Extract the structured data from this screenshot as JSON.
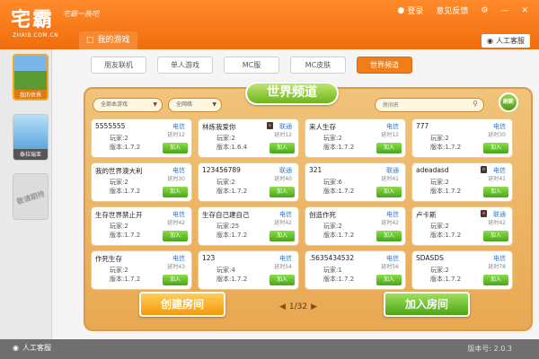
{
  "app": {
    "logo_text": "宅霸",
    "logo_sub": "ZHAIB.COM.CN",
    "slogan": "宅霸一族吧",
    "login": "登录",
    "feedback": "意见反馈",
    "minimize": "—",
    "close": "✕",
    "my_games_tab": "我的游戏",
    "support_top": "人工客服"
  },
  "sidebar": {
    "items": [
      {
        "label": "我的世界"
      },
      {
        "label": "泰拉瑞亚"
      },
      {
        "label": "敬请期待"
      }
    ]
  },
  "subtabs": [
    {
      "label": "朋友联机"
    },
    {
      "label": "单人游戏"
    },
    {
      "label": "MC服"
    },
    {
      "label": "MC皮肤"
    },
    {
      "label": "世界频道"
    }
  ],
  "board": {
    "title": "世界频道",
    "filter_version": "全部本游戏",
    "filter_net": "全网络",
    "search_placeholder": "房间名",
    "refresh": "刷新",
    "create_button": "创建房间",
    "join_button": "加入房间",
    "page": "1/32"
  },
  "rooms": [
    {
      "name": "5555555",
      "net": "电信",
      "latency": "延时12",
      "players": "玩家:2",
      "version": "版本:1.7.2",
      "join": "加入",
      "locked": false
    },
    {
      "name": "林炼我爱你",
      "net": "联通",
      "latency": "延时12",
      "players": "玩家:2",
      "version": "版本:1.6.4",
      "join": "加入",
      "locked": true
    },
    {
      "name": "来人生存",
      "net": "电信",
      "latency": "延时12",
      "players": "玩家:2",
      "version": "版本:1.7.2",
      "join": "加入",
      "locked": false
    },
    {
      "name": "777",
      "net": "电信",
      "latency": "延时30",
      "players": "玩家:2",
      "version": "版本:1.7.2",
      "join": "加入",
      "locked": false
    },
    {
      "name": "我的世界澳大利",
      "net": "电信",
      "latency": "延时30",
      "players": "玩家:2",
      "version": "版本:1.7.2",
      "join": "加入",
      "locked": false
    },
    {
      "name": "123456789",
      "net": "联通",
      "latency": "延时40",
      "players": "玩家:2",
      "version": "版本:1.7.2",
      "join": "加入",
      "locked": false
    },
    {
      "name": "321",
      "net": "联通",
      "latency": "延时41",
      "players": "玩家:6",
      "version": "版本:1.7.2",
      "join": "加入",
      "locked": false
    },
    {
      "name": "adeadasd",
      "net": "电信",
      "latency": "延时41",
      "players": "玩家:2",
      "version": "版本:1.7.2",
      "join": "加入",
      "locked": true
    },
    {
      "name": "生存世界禁止开",
      "net": "电信",
      "latency": "延时42",
      "players": "玩家:2",
      "version": "版本:1.7.2",
      "join": "加入",
      "locked": false
    },
    {
      "name": "生存自己建自己",
      "net": "电信",
      "latency": "延时42",
      "players": "玩家:25",
      "version": "版本:1.7.2",
      "join": "加入",
      "locked": false
    },
    {
      "name": "创造作死",
      "net": "电信",
      "latency": "延时42",
      "players": "玩家:2",
      "version": "版本:1.7.2",
      "join": "加入",
      "locked": false
    },
    {
      "name": "卢卡斯",
      "net": "联通",
      "latency": "延时42",
      "players": "玩家:2",
      "version": "版本:1.7.2",
      "join": "加入",
      "locked": true
    },
    {
      "name": "作死生存",
      "net": "电信",
      "latency": "延时43",
      "players": "玩家:2",
      "version": "版本:1.7.2",
      "join": "加入",
      "locked": false
    },
    {
      "name": "123",
      "net": "电信",
      "latency": "延时54",
      "players": "玩家:4",
      "version": "版本:1.7.2",
      "join": "加入",
      "locked": false
    },
    {
      "name": ".5635434532",
      "net": "电信",
      "latency": "延时56",
      "players": "玩家:1",
      "version": "版本:1.7.2",
      "join": "加入",
      "locked": false
    },
    {
      "name": "SDASDS",
      "net": "电信",
      "latency": "延时78",
      "players": "玩家:2",
      "version": "版本:1.7.2",
      "join": "加入",
      "locked": false
    }
  ],
  "footer": {
    "support": "人工客服",
    "version": "版本号: 2.0.3"
  },
  "colors": {
    "brand_orange": "#f07d17",
    "accent_green": "#4aa516",
    "telecom_blue": "#2a7bd8"
  }
}
